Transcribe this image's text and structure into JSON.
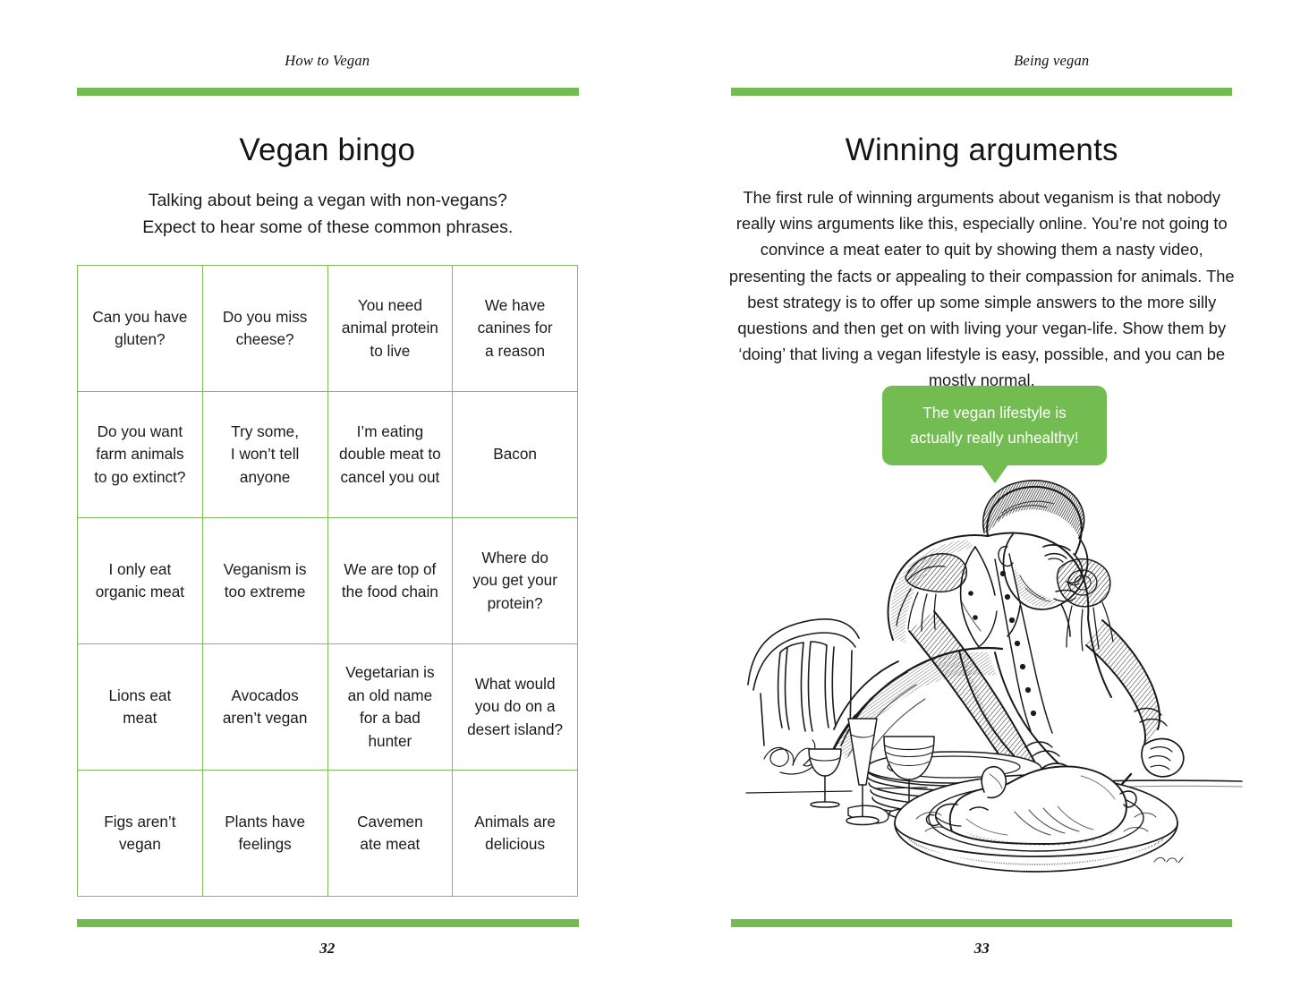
{
  "spread": {
    "accent_color": "#73bc52",
    "grid_border_color": "#7fbd5c",
    "text_color": "#1b1b1b"
  },
  "left_page": {
    "running_head": "How to Vegan",
    "title": "Vegan bingo",
    "subtitle_line1": "Talking about being a vegan with non-vegans?",
    "subtitle_line2": "Expect to hear some of these common phrases.",
    "folio": "32",
    "bingo": {
      "columns": 4,
      "rows": 5,
      "cells": [
        "Can you have\ngluten?",
        "Do you miss\ncheese?",
        "You need\nanimal protein\nto live",
        "We have\ncanines for\na reason",
        "Do you want\nfarm animals\nto go extinct?",
        "Try some,\nI won’t tell\nanyone",
        "I’m eating\ndouble meat to\ncancel you out",
        "Bacon",
        "I only eat\norganic meat",
        "Veganism is\ntoo extreme",
        "We are top of\nthe food chain",
        "Where do\nyou get your\nprotein?",
        "Lions eat\nmeat",
        "Avocados\naren’t vegan",
        "Vegetarian is\nan old name\nfor a bad\nhunter",
        "What would\nyou do on a\ndesert island?",
        "Figs aren’t\nvegan",
        "Plants have\nfeelings",
        "Cavemen\nate meat",
        "Animals are\ndelicious"
      ]
    }
  },
  "right_page": {
    "running_head": "Being vegan",
    "title": "Winning arguments",
    "body": "The first rule of winning arguments about veganism is that nobody really wins arguments like this, especially online. You’re not going to convince a meat eater to quit by showing them a nasty video, presenting the facts or appealing to their compassion for animals. The best strategy is to offer up some simple answers to the more silly questions and then get on with living your vegan-life. Show them by ‘doing’ that living a vegan lifestyle is easy, possible, and you can be mostly normal.",
    "speech_bubble": "The vegan lifestyle is actually really unhealthy!",
    "illustration_caption": "",
    "folio": "33"
  }
}
